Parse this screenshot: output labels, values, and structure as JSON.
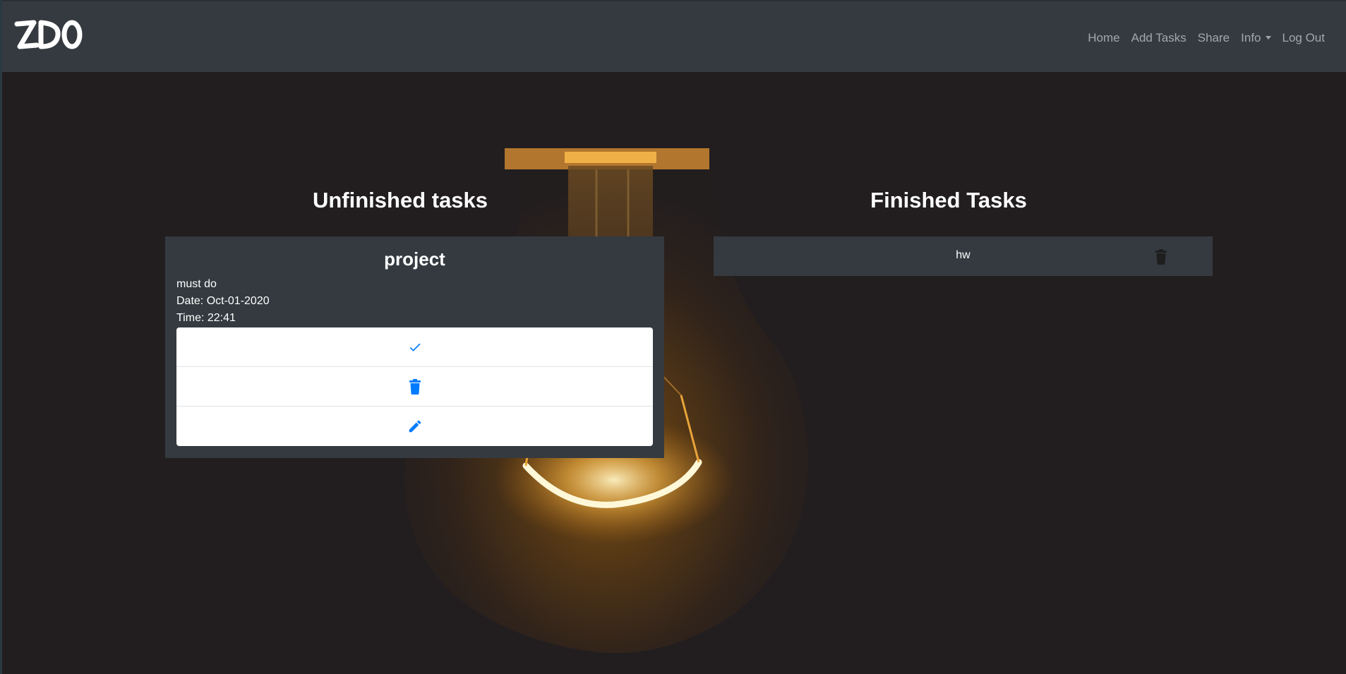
{
  "navbar": {
    "brand": "ZDO",
    "links": {
      "home": "Home",
      "add_tasks": "Add Tasks",
      "share": "Share",
      "info": "Info",
      "log_out": "Log Out"
    }
  },
  "unfinished": {
    "heading": "Unfinished tasks",
    "tasks": [
      {
        "title": "project",
        "description": "must do",
        "date": "Date: Oct-01-2020",
        "time": "Time: 22:41",
        "actions": {
          "complete_icon": "check-icon",
          "delete_icon": "trash-icon",
          "edit_icon": "pencil-icon"
        }
      }
    ]
  },
  "finished": {
    "heading": "Finished Tasks",
    "tasks": [
      {
        "title": "hw",
        "delete_icon": "trash-icon"
      }
    ]
  },
  "colors": {
    "navbar": "#343a40",
    "background": "#221e1f",
    "accent": "#007bff",
    "nav_link": "rgba(255,255,255,0.55)"
  }
}
